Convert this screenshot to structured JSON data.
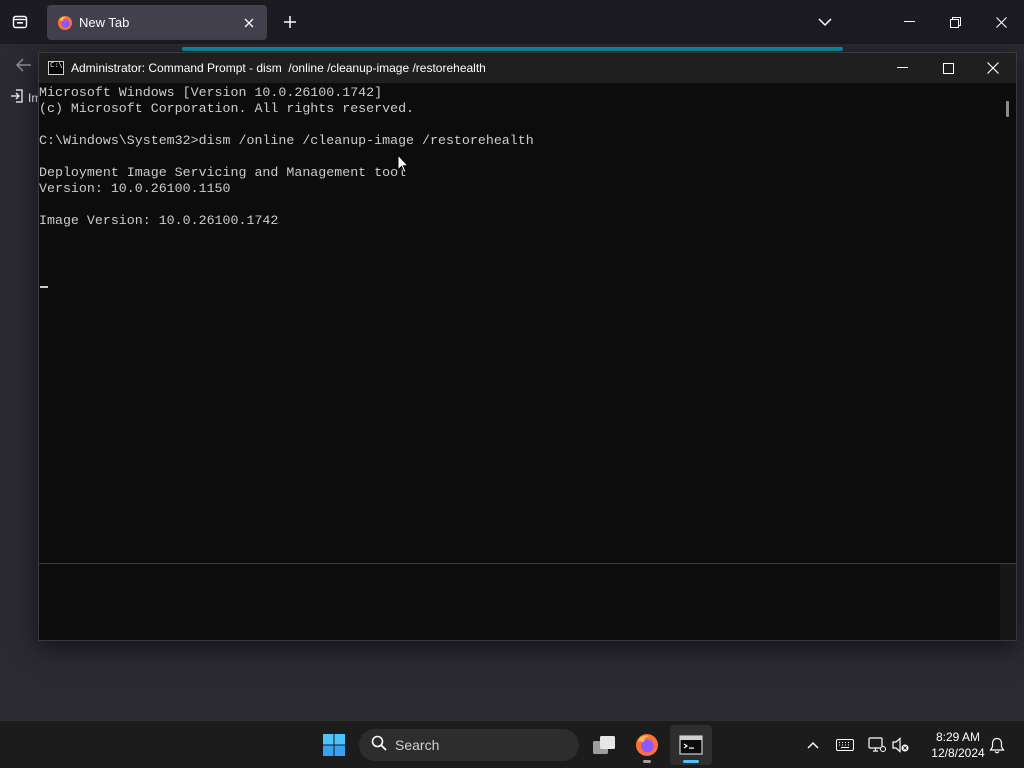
{
  "browser": {
    "tab_title": "New Tab",
    "import_label": "Im",
    "accent_color": "#00ddff"
  },
  "cmd": {
    "title": "Administrator: Command Prompt - dism  /online /cleanup-image /restorehealth",
    "lines": [
      "Microsoft Windows [Version 10.0.26100.1742]",
      "(c) Microsoft Corporation. All rights reserved.",
      "",
      "C:\\Windows\\System32>dism /online /cleanup-image /restorehealth",
      "",
      "Deployment Image Servicing and Management tool",
      "Version: 10.0.26100.1150",
      "",
      "Image Version: 10.0.26100.1742"
    ],
    "background": "#0c0c0c",
    "text_color": "#cccccc"
  },
  "taskbar": {
    "search_placeholder": "Search",
    "time": "8:29 AM",
    "date": "12/8/2024",
    "apps": [
      "start-icon",
      "task-view-icon",
      "firefox-icon",
      "terminal-icon"
    ],
    "tray_icons": [
      "chevron-up-icon",
      "keyboard-icon",
      "network-icon",
      "volume-muted-icon",
      "notification-bell-icon"
    ]
  }
}
